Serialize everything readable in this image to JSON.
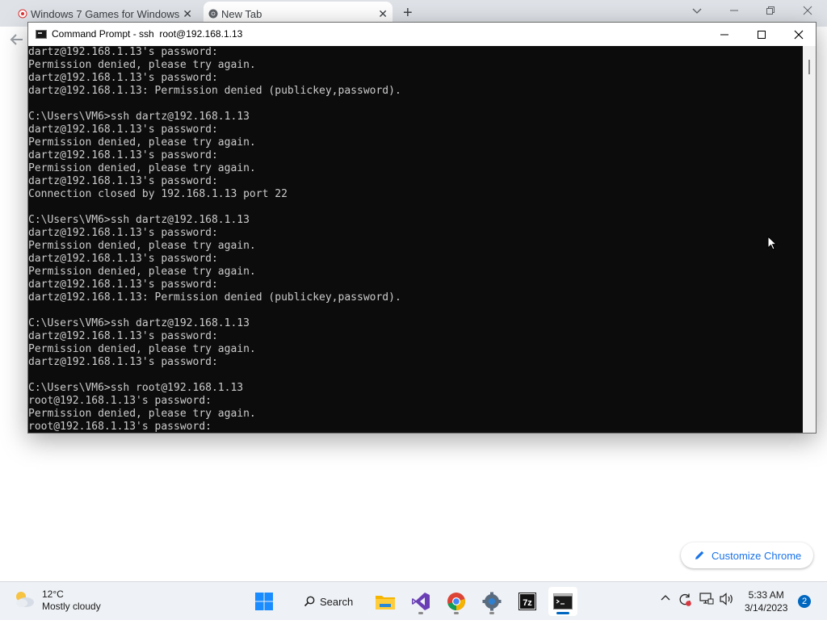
{
  "chrome": {
    "tabs": [
      {
        "title": "Windows 7 Games for Windows",
        "close": "✕"
      },
      {
        "title": "New Tab",
        "close": "✕"
      }
    ],
    "new_tab": "+",
    "customize_label": "Customize Chrome"
  },
  "cmd": {
    "title": "Command Prompt - ssh  root@192.168.1.13",
    "lines": [
      "dartz@192.168.1.13's password:",
      "Permission denied, please try again.",
      "dartz@192.168.1.13's password:",
      "dartz@192.168.1.13: Permission denied (publickey,password).",
      "",
      "C:\\Users\\VM6>ssh dartz@192.168.1.13",
      "dartz@192.168.1.13's password:",
      "Permission denied, please try again.",
      "dartz@192.168.1.13's password:",
      "Permission denied, please try again.",
      "dartz@192.168.1.13's password:",
      "Connection closed by 192.168.1.13 port 22",
      "",
      "C:\\Users\\VM6>ssh dartz@192.168.1.13",
      "dartz@192.168.1.13's password:",
      "Permission denied, please try again.",
      "dartz@192.168.1.13's password:",
      "Permission denied, please try again.",
      "dartz@192.168.1.13's password:",
      "dartz@192.168.1.13: Permission denied (publickey,password).",
      "",
      "C:\\Users\\VM6>ssh dartz@192.168.1.13",
      "dartz@192.168.1.13's password:",
      "Permission denied, please try again.",
      "dartz@192.168.1.13's password:",
      "",
      "C:\\Users\\VM6>ssh root@192.168.1.13",
      "root@192.168.1.13's password:",
      "Permission denied, please try again.",
      "root@192.168.1.13's password:"
    ]
  },
  "taskbar": {
    "weather": {
      "temp": "12°C",
      "condition": "Mostly cloudy"
    },
    "search_label": "Search",
    "clock": {
      "time": "5:33 AM",
      "date": "3/14/2023"
    },
    "notification_count": "2"
  },
  "colors": {
    "console_bg": "#0c0c0c",
    "console_text": "#cccccc",
    "accent": "#0067c0",
    "chrome_link": "#1a73e8"
  }
}
